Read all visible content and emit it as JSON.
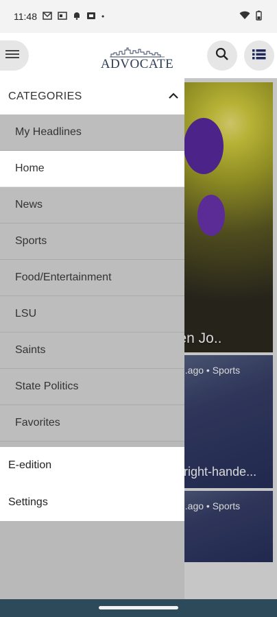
{
  "status_bar": {
    "time": "11:48",
    "icons": [
      "gmail-icon",
      "news-icon",
      "bell-icon",
      "cast-icon",
      "dot-icon"
    ],
    "right_icons": [
      "wifi-icon",
      "battery-icon"
    ]
  },
  "header": {
    "logo_text": "ADVOCATE",
    "menu_icon": "hamburger-icon",
    "search_icon": "search-icon",
    "list_icon": "list-icon"
  },
  "background": {
    "hero_caption": "LSU baseball star Brayden Jo..",
    "card_right_meta": "...ago • Sports",
    "card_right_caption": "right-hande...",
    "card_right2_meta": "...ago • Sports"
  },
  "drawer": {
    "categories_label": "CATEGORIES",
    "items": [
      {
        "label": "My Headlines"
      },
      {
        "label": "Home"
      },
      {
        "label": "News"
      },
      {
        "label": "Sports"
      },
      {
        "label": "Food/Entertainment"
      },
      {
        "label": "LSU"
      },
      {
        "label": "Saints"
      },
      {
        "label": "State Politics"
      },
      {
        "label": "Favorites"
      }
    ],
    "footer_items": [
      {
        "label": "E-edition"
      },
      {
        "label": "Settings"
      }
    ]
  },
  "colors": {
    "navbar": "#2c4a5a",
    "logo": "#2b3a55",
    "drawer_bg": "#bdbdbd",
    "active_item": "#ffffff"
  }
}
